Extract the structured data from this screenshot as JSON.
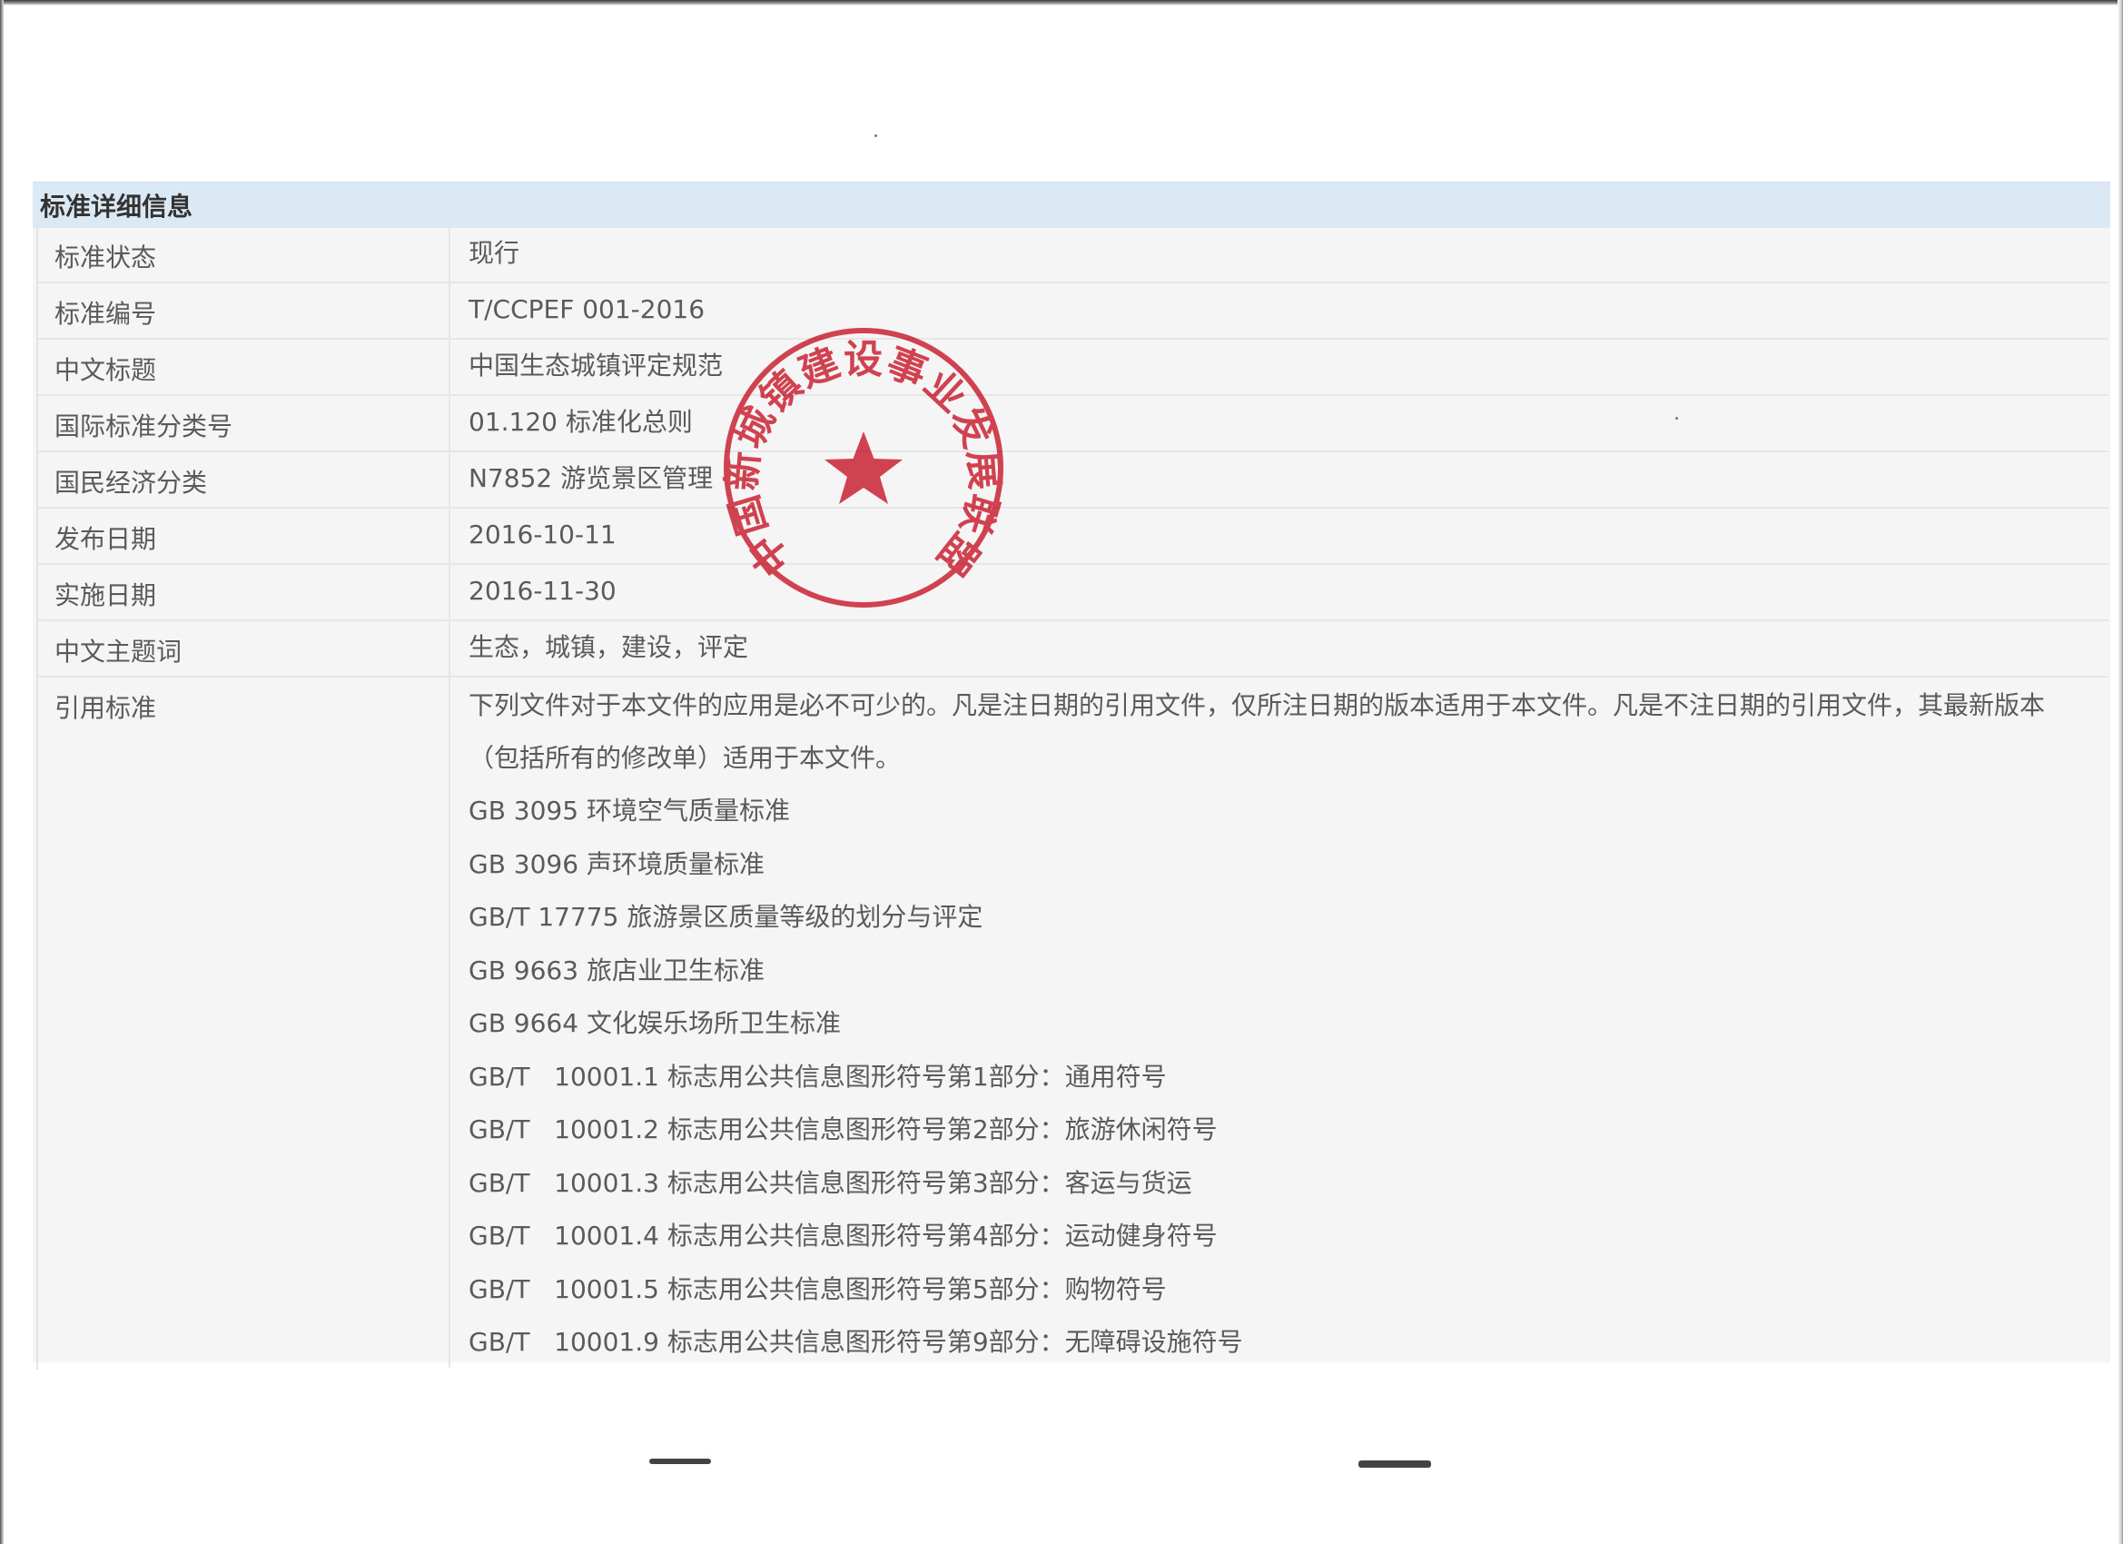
{
  "panel": {
    "title": "标准详细信息"
  },
  "rows": [
    {
      "label": "标准状态",
      "value": "现行"
    },
    {
      "label": "标准编号",
      "value": "T/CCPEF 001-2016"
    },
    {
      "label": "中文标题",
      "value": "中国生态城镇评定规范"
    },
    {
      "label": "国际标准分类号",
      "value": "01.120 标准化总则"
    },
    {
      "label": "国民经济分类",
      "value": "N7852 游览景区管理"
    },
    {
      "label": "发布日期",
      "value": "2016-10-11"
    },
    {
      "label": "实施日期",
      "value": "2016-11-30"
    },
    {
      "label": "中文主题词",
      "value": "生态，城镇，建设，评定"
    }
  ],
  "references": {
    "label": "引用标准",
    "intro": "下列文件对于本文件的应用是必不可少的。凡是注日期的引用文件，仅所注日期的版本适用于本文件。凡是不注日期的引用文件，其最新版本（包括所有的修改单）适用于本文件。",
    "items": [
      "GB 3095 环境空气质量标准",
      "GB 3096 声环境质量标准",
      "GB/T 17775 旅游景区质量等级的划分与评定",
      "GB 9663 旅店业卫生标准",
      "GB 9664 文化娱乐场所卫生标准",
      "GB/T   10001.1 标志用公共信息图形符号第1部分：通用符号",
      "GB/T   10001.2 标志用公共信息图形符号第2部分：旅游休闲符号",
      "GB/T   10001.3 标志用公共信息图形符号第3部分：客运与货运",
      "GB/T   10001.4 标志用公共信息图形符号第4部分：运动健身符号",
      "GB/T   10001.5 标志用公共信息图形符号第5部分：购物符号",
      "GB/T   10001.9 标志用公共信息图形符号第9部分：无障碍设施符号"
    ]
  },
  "stamp": {
    "text": "中国新城镇建设事业发展联盟",
    "color": "#d42a3a",
    "icon": "star-icon"
  }
}
